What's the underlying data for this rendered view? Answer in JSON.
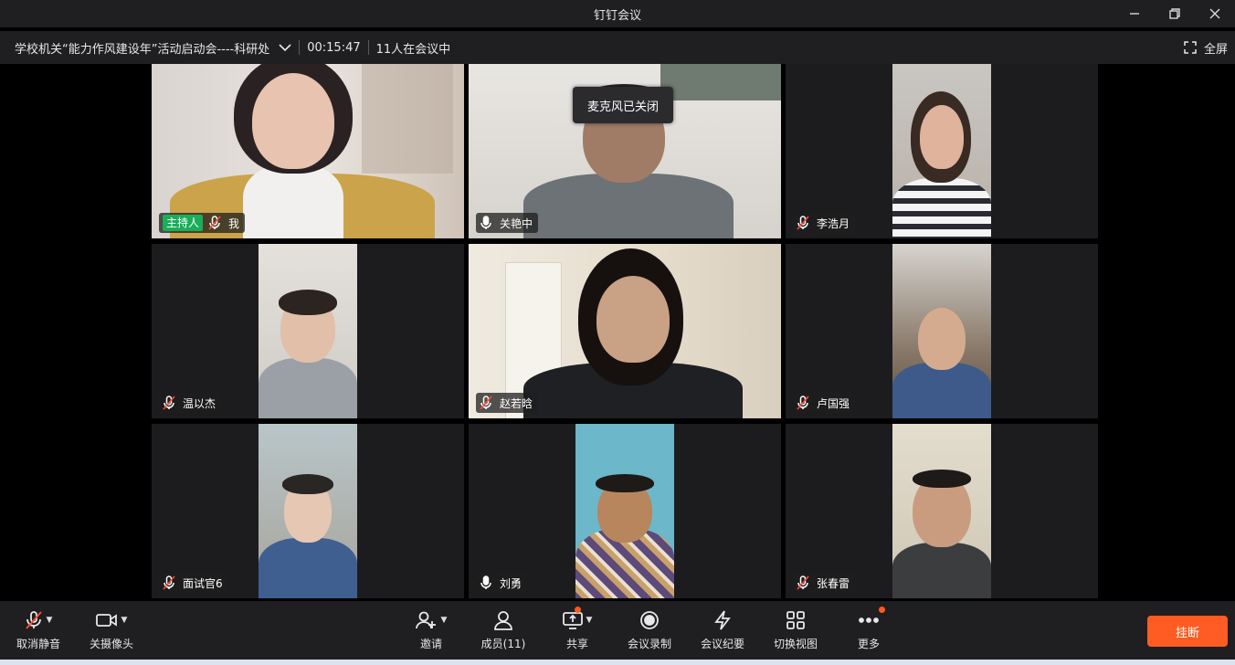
{
  "window": {
    "title": "钉钉会议"
  },
  "meeting": {
    "name": "学校机关“能力作风建设年”活动启动会----科研处",
    "timer": "00:15:47",
    "attendance": "11人在会议中",
    "fullscreen_label": "全屏"
  },
  "tooltip": "麦克风已关闭",
  "host_badge": "主持人",
  "participants": [
    {
      "name": "我",
      "mic": "muted",
      "host": true
    },
    {
      "name": "关艳中",
      "mic": "on",
      "host": false
    },
    {
      "name": "李浩月",
      "mic": "muted",
      "host": false
    },
    {
      "name": "温以杰",
      "mic": "muted",
      "host": false
    },
    {
      "name": "赵若晗",
      "mic": "muted",
      "host": false
    },
    {
      "name": "卢国强",
      "mic": "muted",
      "host": false
    },
    {
      "name": "面试官6",
      "mic": "muted",
      "host": false
    },
    {
      "name": "刘勇",
      "mic": "on",
      "host": false
    },
    {
      "name": "张春雷",
      "mic": "muted",
      "host": false
    }
  ],
  "toolbar": {
    "unmute": "取消静音",
    "camera_off": "关摄像头",
    "invite": "邀请",
    "members": "成员(11)",
    "share": "共享",
    "record": "会议录制",
    "minutes": "会议纪要",
    "switch_view": "切换视图",
    "more": "更多",
    "hangup": "挂断"
  },
  "colors": {
    "accent": "#fe5c22",
    "host_badge": "#1aad5a",
    "background": "#1f1f21"
  }
}
